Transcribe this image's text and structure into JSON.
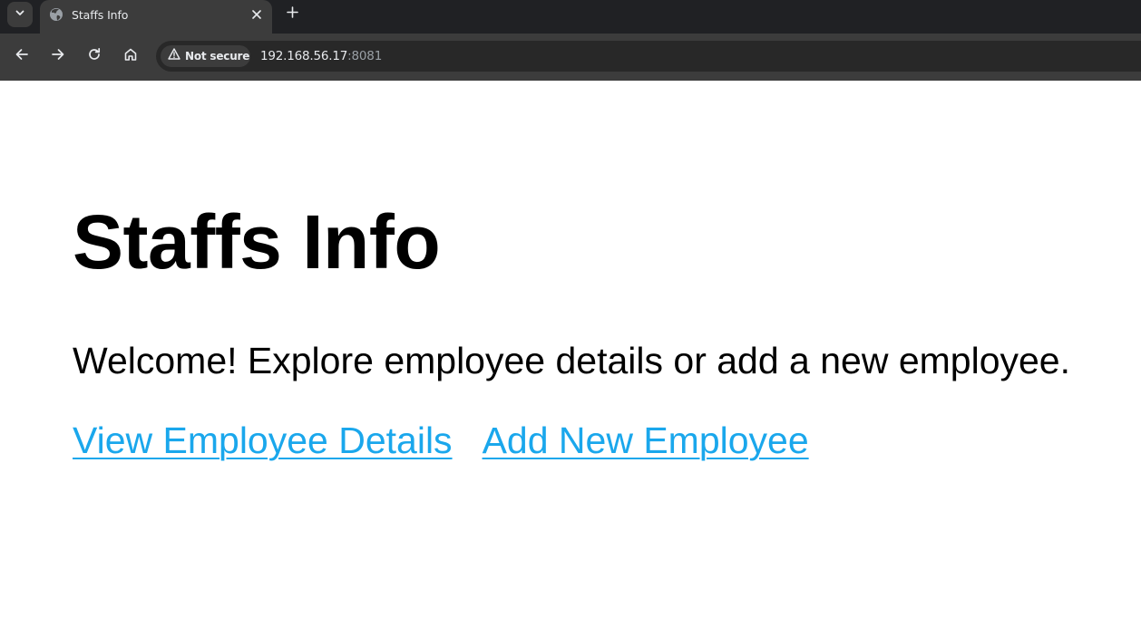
{
  "browser": {
    "tab": {
      "title": "Staffs Info",
      "favicon": "globe-icon"
    },
    "omnibox": {
      "security_label": "Not secure",
      "url_host": "192.168.56.17",
      "url_port": ":8081"
    },
    "colors": {
      "tabstrip_bg": "#202124",
      "toolbar_bg": "#3c3c3c",
      "omnibox_bg": "#282828",
      "text_light": "#e8eaed"
    }
  },
  "page": {
    "title": "Staffs Info",
    "welcome_text": "Welcome! Explore employee details or add a new employee.",
    "links": {
      "view_details": "View Employee Details",
      "add_new": "Add New Employee"
    },
    "colors": {
      "link": "#1aa7ec",
      "text": "#000000",
      "background": "#ffffff"
    }
  }
}
